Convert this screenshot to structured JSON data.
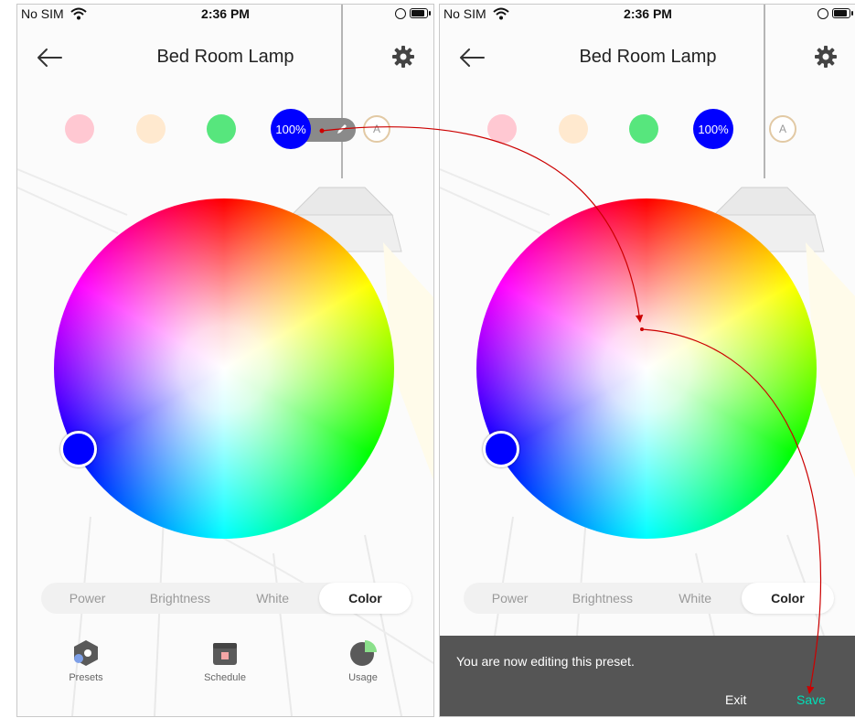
{
  "left": {
    "status": {
      "carrier": "No SIM",
      "time": "2:36 PM"
    },
    "title": "Bed Room Lamp",
    "presets": {
      "active_label": "100%",
      "auto_label": "A"
    },
    "tabs": [
      "Power",
      "Brightness",
      "White",
      "Color"
    ],
    "active_tab": "Color",
    "nav": {
      "presets": "Presets",
      "schedule": "Schedule",
      "usage": "Usage"
    }
  },
  "right": {
    "status": {
      "carrier": "No SIM",
      "time": "2:36 PM"
    },
    "title": "Bed Room Lamp",
    "presets": {
      "active_label": "100%",
      "auto_label": "A"
    },
    "tabs": [
      "Power",
      "Brightness",
      "White",
      "Color"
    ],
    "active_tab": "Color",
    "toast": {
      "message": "You are now editing this preset.",
      "exit": "Exit",
      "save": "Save"
    }
  },
  "colors": {
    "preset_pink": "#ffc8d2",
    "preset_cream": "#ffe9cf",
    "preset_green": "#57e67d",
    "preset_blue": "#0000ff",
    "save_accent": "#00e0b8",
    "annotation_arrow": "#cc0000"
  },
  "icons": [
    "wifi-icon",
    "battery-icon",
    "back-arrow-icon",
    "gear-icon",
    "edit-pencil-icon",
    "presets-icon",
    "schedule-icon",
    "usage-icon"
  ]
}
